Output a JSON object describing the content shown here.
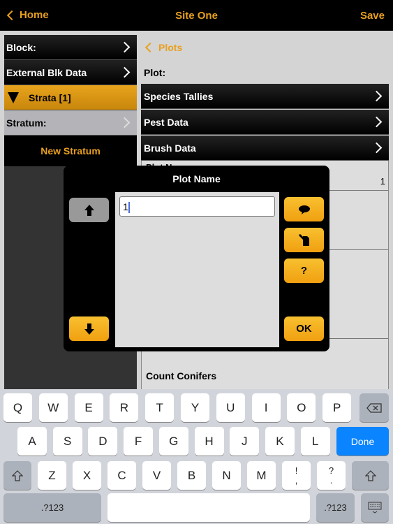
{
  "nav": {
    "back": "Home",
    "title": "Site One",
    "save": "Save"
  },
  "left": {
    "block": "Block:",
    "external": "External Blk Data",
    "strata": "Strata [1]",
    "stratum": "Stratum:",
    "new_stratum": "New Stratum"
  },
  "right": {
    "back": "Plots",
    "plot_label": "Plot:",
    "rows": [
      "Species Tallies",
      "Pest Data",
      "Brush Data"
    ],
    "plot_name_partial": "Plot N",
    "plot_name_value": "1",
    "count_conifers": "Count Conifers"
  },
  "modal": {
    "title": "Plot Name",
    "value": "1",
    "ok": "OK",
    "help": "?"
  },
  "keyboard": {
    "row1": [
      "Q",
      "W",
      "E",
      "R",
      "T",
      "Y",
      "U",
      "I",
      "O",
      "P"
    ],
    "row2": [
      "A",
      "S",
      "D",
      "F",
      "G",
      "H",
      "J",
      "K",
      "L"
    ],
    "row3": [
      "Z",
      "X",
      "C",
      "V",
      "B",
      "N",
      "M"
    ],
    "punct": [
      [
        "!",
        ","
      ],
      [
        "?",
        "."
      ]
    ],
    "done": "Done",
    "numbers": ".?123"
  },
  "colors": {
    "accent": "#e8a020",
    "done": "#0a84ff"
  }
}
